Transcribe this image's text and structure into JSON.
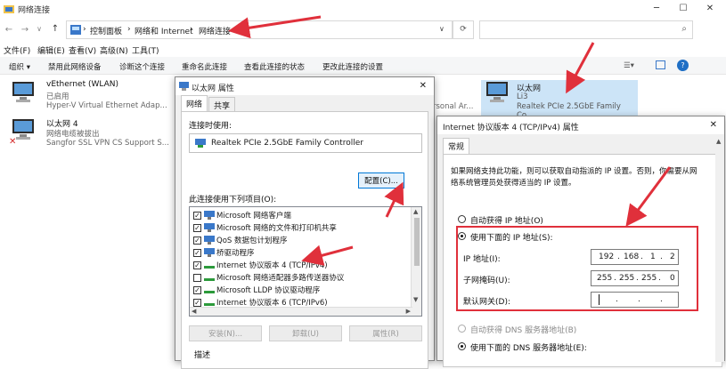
{
  "explorer": {
    "window_title": "网络连接",
    "breadcrumb": [
      "控制面板",
      "网络和 Internet",
      "网络连接"
    ],
    "breadcrumb_sep": "›",
    "menu": [
      "文件(F)",
      "编辑(E)",
      "查看(V)",
      "高级(N)",
      "工具(T)"
    ],
    "commands": [
      "组织 ▾",
      "禁用此网络设备",
      "诊断这个连接",
      "重命名此连接",
      "查看此连接的状态",
      "更改此连接的设置"
    ],
    "adapters": [
      {
        "name": "vEthernet (WLAN)",
        "status": "已启用",
        "device": "Hyper-V Virtual Ethernet Adap..."
      },
      {
        "name": "以太网 4",
        "status": "网络电缆被拔出",
        "device": "Sangfor SSL VPN CS Support S..."
      },
      {
        "name": "以太网",
        "status": "Li3",
        "device": "Realtek PCIe 2.5GbE Family Co..."
      }
    ],
    "partial_adapter_text": "rsonal Ar..."
  },
  "eth_dialog": {
    "title": "以太网 属性",
    "tabs": [
      "网络",
      "共享"
    ],
    "connect_using_label": "连接时使用:",
    "adapter_name": "Realtek PCIe 2.5GbE Family Controller",
    "configure_button": "配置(C)...",
    "items_label": "此连接使用下列项目(O):",
    "items": [
      {
        "label": "Microsoft 网络客户端",
        "checked": true
      },
      {
        "label": "Microsoft 网络的文件和打印机共享",
        "checked": true
      },
      {
        "label": "QoS 数据包计划程序",
        "checked": true
      },
      {
        "label": "桥驱动程序",
        "checked": true
      },
      {
        "label": "Internet 协议版本 4 (TCP/IPv4)",
        "checked": true
      },
      {
        "label": "Microsoft 网络适配器多路传送器协议",
        "checked": false
      },
      {
        "label": "Microsoft LLDP 协议驱动程序",
        "checked": true
      },
      {
        "label": "Internet 协议版本 6 (TCP/IPv6)",
        "checked": true
      }
    ],
    "install_button": "安装(N)...",
    "uninstall_button": "卸载(U)",
    "properties_button": "属性(R)",
    "description_label": "描述"
  },
  "ipv4_dialog": {
    "title": "Internet 协议版本 4 (TCP/IPv4) 属性",
    "tab": "常规",
    "intro_line1": "如果网络支持此功能，则可以获取自动指派的 IP 设置。否则，你需要从网",
    "intro_line2": "络系统管理员处获得适当的 IP 设置。",
    "auto_ip_label": "自动获得 IP 地址(O)",
    "manual_ip_label": "使用下面的 IP 地址(S):",
    "ip_label": "IP 地址(I):",
    "ip_value": [
      "192",
      "168",
      "1",
      "2"
    ],
    "mask_label": "子网掩码(U):",
    "mask_value": [
      "255",
      "255",
      "255",
      "0"
    ],
    "gateway_label": "默认网关(D):",
    "gateway_value": [
      "",
      "",
      "",
      ""
    ],
    "auto_dns_label": "自动获得 DNS 服务器地址(B)",
    "manual_dns_label": "使用下面的 DNS 服务器地址(E):",
    "ip_mode": "manual",
    "dns_mode": "manual"
  },
  "colors": {
    "annotation_red": "#e0303b",
    "selection": "#cce4f7",
    "focus_blue": "#0078d7"
  }
}
